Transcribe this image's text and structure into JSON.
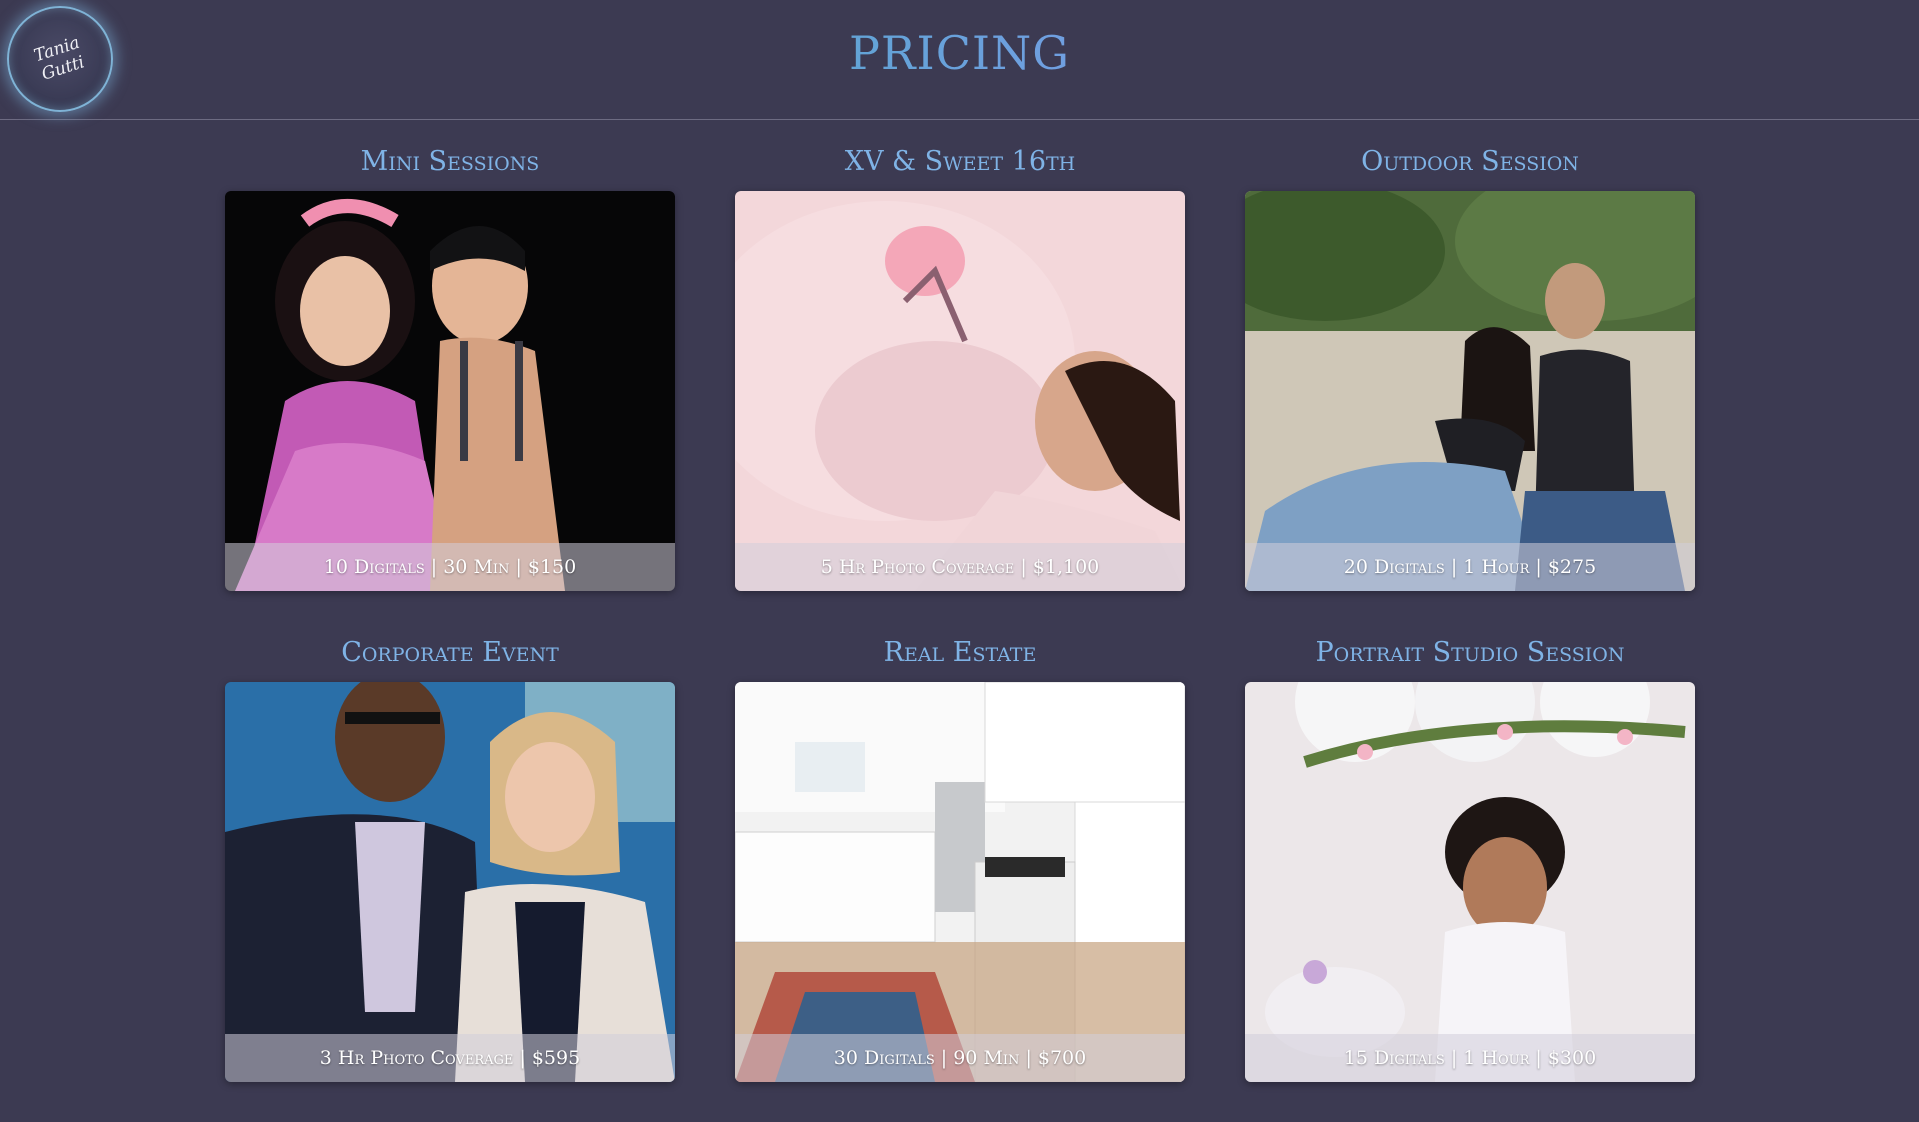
{
  "header": {
    "logo_text": "Tania Gutti",
    "title": "PRICING"
  },
  "packages": [
    {
      "title": "Mini Sessions",
      "details": "10 Digitals |  30 Min |  $150",
      "photo": "children-portrait-photo"
    },
    {
      "title": "XV & Sweet 16th",
      "details": "5 Hr Photo Coverage |  $1,100",
      "photo": "quinceanera-photo"
    },
    {
      "title": "Outdoor Session",
      "details": "20 Digitals |  1 Hour |  $275",
      "photo": "couple-outdoor-photo"
    },
    {
      "title": "Corporate Event",
      "details": "3 Hr Photo Coverage |  $595",
      "photo": "corporate-event-photo"
    },
    {
      "title": "Real Estate",
      "details": "30 Digitals |  90 Min |  $700",
      "photo": "kitchen-interior-photo"
    },
    {
      "title": "Portrait Studio Session",
      "details": "15 Digitals |  1 Hour |  $300",
      "photo": "toddler-studio-photo"
    }
  ]
}
